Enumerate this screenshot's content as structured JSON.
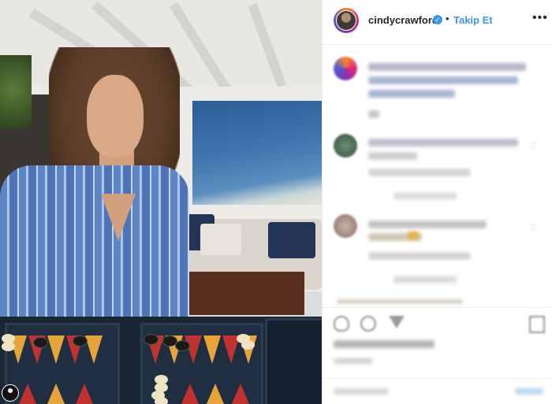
{
  "header": {
    "username": "cindycrawford",
    "verified_badge": "✓",
    "separator": "•",
    "follow_label": "Takip Et",
    "more_label": "•••"
  },
  "colors": {
    "follow_blue": "#3897f0",
    "verified_blue": "#3897f0",
    "text_dark": "#262626",
    "text_muted": "#8e8e8e",
    "divider": "#efefef"
  },
  "icons": {
    "verified": "verified-badge-icon",
    "more": "more-options-icon",
    "like": "heart-icon",
    "comment": "comment-icon",
    "share": "share-icon",
    "save": "bookmark-icon",
    "media_user": "user-tag-icon"
  }
}
